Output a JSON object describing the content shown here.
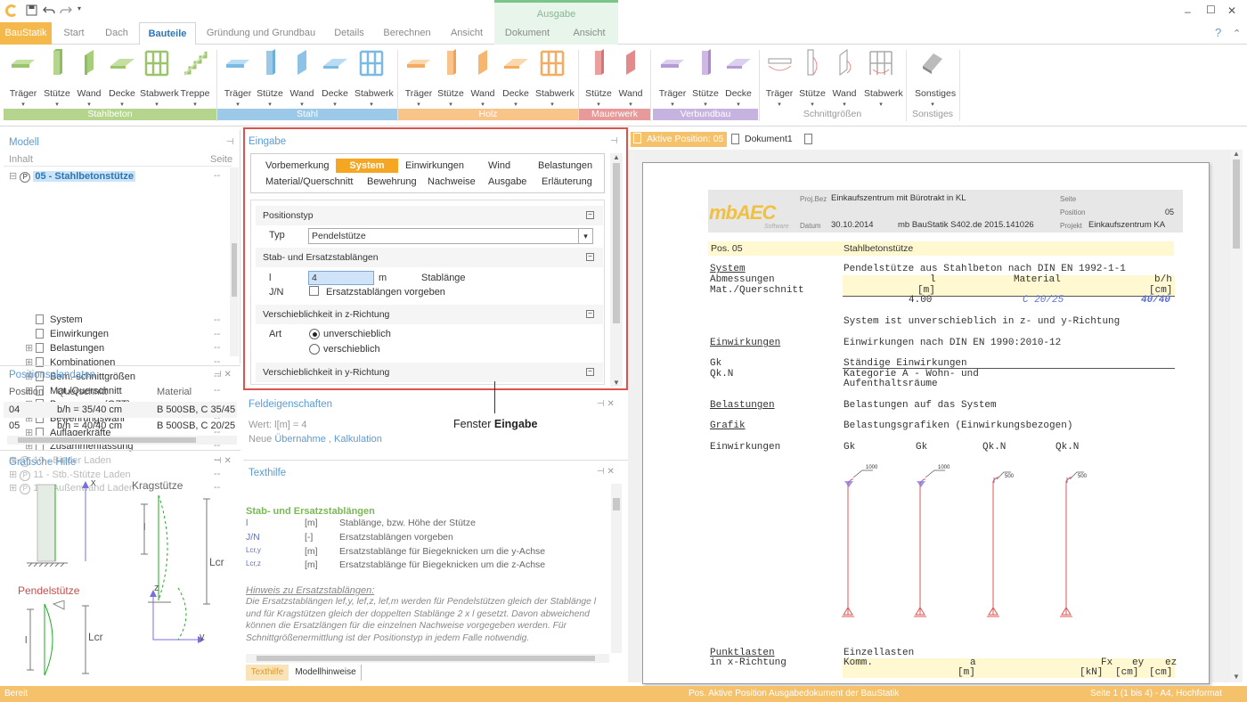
{
  "app": {
    "quick_access": [
      "save-icon",
      "undo-icon",
      "redo-icon"
    ],
    "context_header": "Ausgabe",
    "window_controls": {
      "minimize": "–",
      "maximize": "☐",
      "close": "✕",
      "help": "?",
      "collapse": "⌃"
    }
  },
  "tabs": [
    {
      "label": "BauStatik"
    },
    {
      "label": "Start"
    },
    {
      "label": "Dach"
    },
    {
      "label": "Bauteile"
    },
    {
      "label": "Gründung und Grundbau"
    },
    {
      "label": "Details"
    },
    {
      "label": "Berechnen"
    },
    {
      "label": "Ansicht"
    },
    {
      "label": "Dokument"
    },
    {
      "label": "Ansicht"
    }
  ],
  "ribbon": {
    "stahlbeton": {
      "label": "Stahlbeton",
      "items": [
        "Träger",
        "Stütze",
        "Wand",
        "Decke",
        "Stabwerk",
        "Treppe"
      ]
    },
    "stahl": {
      "label": "Stahl",
      "items": [
        "Träger",
        "Stütze",
        "Wand",
        "Decke",
        "Stabwerk"
      ]
    },
    "holz": {
      "label": "Holz",
      "items": [
        "Träger",
        "Stütze",
        "Wand",
        "Decke",
        "Stabwerk"
      ]
    },
    "mauerwerk": {
      "label": "Mauerwerk",
      "items": [
        "Stütze",
        "Wand"
      ]
    },
    "verbundbau": {
      "label": "Verbundbau",
      "items": [
        "Träger",
        "Stütze",
        "Decke"
      ]
    },
    "schnittgroessen": {
      "label": "Schnittgrößen",
      "items": [
        "Träger",
        "Stütze",
        "Wand",
        "Stabwerk"
      ]
    },
    "sonstiges": {
      "label": "Sonstiges",
      "items": [
        "Sonstiges"
      ]
    },
    "colors": {
      "stahlbeton": "#b5d58f",
      "stahl": "#9cc9e8",
      "holz": "#f8c48a",
      "mauerwerk": "#e89a9a",
      "verbundbau": "#c7b3e0",
      "brand": "#f5b84a",
      "accent": "#2e75b6"
    }
  },
  "modell": {
    "title": "Modell",
    "col_inhalt": "Inhalt",
    "col_seite": "Seite",
    "root": {
      "label": "05 - Stahlbetonstütze",
      "badge": "P",
      "seite": "--"
    },
    "items": [
      {
        "label": "System",
        "seite": "--"
      },
      {
        "label": "Einwirkungen",
        "seite": "--"
      },
      {
        "label": "Belastungen",
        "seite": "--"
      },
      {
        "label": "Kombinationen",
        "seite": "--"
      },
      {
        "label": "Bem.-schnittgrößen",
        "seite": "--"
      },
      {
        "label": "Mat./Querschnitt",
        "seite": "--"
      },
      {
        "label": "Bemessung (GZT)",
        "seite": "--"
      },
      {
        "label": "Bewehrungswahl",
        "seite": "--"
      },
      {
        "label": "Auflagerkräfte",
        "seite": "--"
      },
      {
        "label": "Zusammenfassung",
        "seite": "--"
      }
    ],
    "others": [
      {
        "label": "10 - Binder Laden",
        "seite": "--"
      },
      {
        "label": "11 - Stb.-Stütze Laden",
        "seite": "--"
      },
      {
        "label": "12 - Außenwand Laden",
        "seite": "--"
      }
    ]
  },
  "positionsplandaten": {
    "title": "Positionsplandaten",
    "headers": [
      "Position",
      "Querschnitt",
      "Material"
    ],
    "rows": [
      [
        "04",
        "b/h = 35/40 cm",
        "B 500SB, C 35/45"
      ],
      [
        "05",
        "b/h = 40/40 cm",
        "B 500SB, C 20/25"
      ]
    ]
  },
  "grafische_hilfe": {
    "title": "Grafische Hilfe",
    "kragstuetze": "Kragstütze",
    "pendelstuetze": "Pendelstütze",
    "labels": {
      "x": "x",
      "l": "l",
      "lcr": "Lcr",
      "lcr2": "Lcr",
      "z": "z",
      "y": "y"
    }
  },
  "eingabe": {
    "title": "Eingabe",
    "tabs_row1": [
      "Vorbemerkung",
      "System",
      "Einwirkungen",
      "Wind",
      "Belastungen"
    ],
    "tabs_row2": [
      "Material/Querschnitt",
      "Bewehrung",
      "Nachweise",
      "Ausgabe",
      "Erläuterung"
    ],
    "positionstyp": {
      "header": "Positionstyp",
      "typ_label": "Typ",
      "typ_value": "Pendelstütze"
    },
    "stablaengen": {
      "header": "Stab- und Ersatzstablängen",
      "l_label": "l",
      "l_value": "4",
      "l_unit": "m",
      "l_desc": "Stablänge",
      "jn_label": "J/N",
      "jn_desc": "Ersatzstablängen vorgeben"
    },
    "verschieb_z": {
      "header": "Verschieblichkeit in z-Richtung",
      "art_label": "Art",
      "opt1": "unverschieblich",
      "opt2": "verschieblich"
    },
    "verschieb_y": {
      "header": "Verschieblichkeit in y-Richtung"
    }
  },
  "callout": {
    "prefix": "Fenster ",
    "bold": "Eingabe"
  },
  "feldeigenschaften": {
    "title": "Feldeigenschaften",
    "wert": "Wert: l[m] = 4",
    "neue": "Neue ",
    "uebernahme": "Übernahme",
    "comma": " , ",
    "kalkulation": "Kalkulation"
  },
  "texthilfe": {
    "title": "Texthilfe",
    "heading": "Stab- und Ersatzstablängen",
    "rows": [
      {
        "sym": "l",
        "unit": "[m]",
        "desc": "Stablänge, bzw. Höhe der Stütze"
      },
      {
        "sym": "J/N",
        "unit": "[-]",
        "desc": "Ersatzstablängen vorgeben"
      },
      {
        "sym": "Lcr,y",
        "unit": "[m]",
        "desc": "Ersatzstablänge für Biegeknicken um die y-Achse"
      },
      {
        "sym": "Lcr,z",
        "unit": "[m]",
        "desc": "Ersatzstablänge für Biegeknicken um die z-Achse"
      }
    ],
    "hinweis_title": "Hinweis zu Ersatzstablängen:",
    "hinweis_lines": [
      "Die Ersatzstablängen lef,y, lef,z, lef,m werden für Pendelstützen gleich der Stablänge l",
      "und für Kragstützen gleich der doppelten Stablänge 2 x l gesetzt. Davon abweichend",
      "können die Ersatzlängen für die einzelnen Nachweise vorgegeben werden. Für",
      "Schnittgrößenermittlung ist der Positionstyp in jedem Falle notwendig."
    ],
    "tab1": "Texthilfe",
    "tab2": "Modellhinweise"
  },
  "doc": {
    "tab1": "Aktive Position: 05",
    "tab2": "Dokument1",
    "header": {
      "logo": "mbAEC",
      "logo_sub": "Software",
      "projbez_label": "Proj.Bez",
      "projbez": "Einkaufszentrum mit Bürotrakt in KL",
      "seite_label": "Seite",
      "position_label": "Position",
      "position": "05",
      "datum_label": "Datum",
      "datum": "30.10.2014",
      "software": "mb BauStatik S402.de  2015.141026",
      "projekt_label": "Projekt",
      "projekt": "Einkaufszentrum KA"
    },
    "pos": "Pos. 05",
    "pos_title": "Stahlbetonstütze",
    "system_label": "System",
    "system_text": "Pendelstütze aus Stahlbeton nach DIN EN 1992-1-1",
    "abm_label": "Abmessungen",
    "mat_label": "Mat./Querschnitt",
    "tbl_h1": "l",
    "tbl_h2": "Material",
    "tbl_h3": "b/h",
    "tbl_u1": "[m]",
    "tbl_u3": "[cm]",
    "tbl_v1": "4.00",
    "tbl_v2": "C 20/25",
    "tbl_v3": "40/40",
    "system_note": "System ist unverschieblich in z- und y-Richtung",
    "einw_label": "Einwirkungen",
    "einw_text": "Einwirkungen nach DIN EN 1990:2010-12",
    "gk": "Gk",
    "gk_desc": "Ständige Einwirkungen",
    "qkn": "Qk.N",
    "qkn_desc1": "Kategorie A - Wohn- und",
    "qkn_desc2": "Aufenthaltsräume",
    "bel_label": "Belastungen",
    "bel_text": "Belastungen auf das System",
    "grafik_label": "Grafik",
    "grafik_text": "Belastungsgrafiken (Einwirkungsbezogen)",
    "einw2": "Einwirkungen",
    "cols": [
      "Gk",
      "Gk",
      "Qk.N",
      "Qk.N"
    ],
    "loads": [
      "1000",
      "1000",
      "500",
      "500"
    ],
    "punkt_label": "Punktlasten",
    "punkt_sub": "in x-Richtung",
    "punkt_text": "Einzellasten",
    "komm": "Komm.",
    "a": "a",
    "am": "[m]",
    "fx": "Fx",
    "ey": "ey",
    "ez": "ez",
    "kn": "[kN]",
    "cm1": "[cm]",
    "cm2": "[cm]"
  },
  "status": {
    "left": "Bereit",
    "mid": "Pos. Aktive Position  Ausgabedokument der BauStatik",
    "right": "Seite 1 (1 bis 4) - A4, Hochformat"
  }
}
